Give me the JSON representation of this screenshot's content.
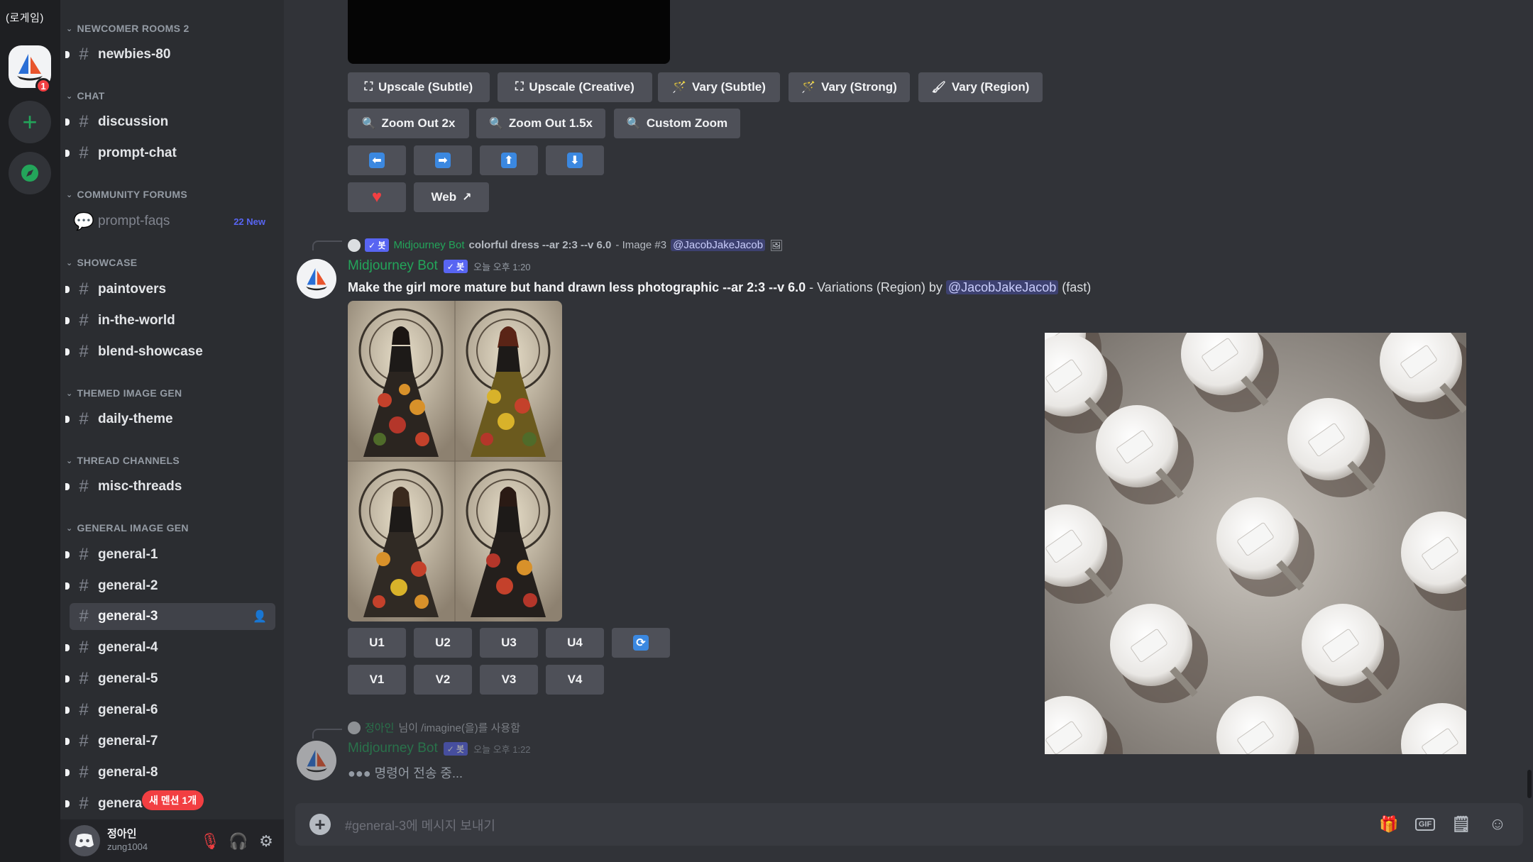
{
  "colors": {
    "accent": "#5865f2",
    "bot_green": "#23a55a",
    "danger": "#f23f42",
    "bg_main": "#313338",
    "bg_sidebar": "#2b2d31",
    "bg_rail": "#1e1f22"
  },
  "rail": {
    "top_label": "(로게임)",
    "server_badge": "1",
    "add_glyph": "+"
  },
  "sidebar": {
    "categories": {
      "newcomer": "NEWCOMER ROOMS 2",
      "chat": "CHAT",
      "forums": "COMMUNITY FORUMS",
      "showcase": "SHOWCASE",
      "themed": "THEMED IMAGE GEN",
      "threads": "THREAD CHANNELS",
      "general": "GENERAL IMAGE GEN"
    },
    "channels": {
      "newbies": "newbies-80",
      "discussion": "discussion",
      "prompt_chat": "prompt-chat",
      "prompt_faqs": "prompt-faqs",
      "prompt_faqs_new": "22 New",
      "paintovers": "paintovers",
      "in_the_world": "in-the-world",
      "blend_showcase": "blend-showcase",
      "daily_theme": "daily-theme",
      "misc_threads": "misc-threads",
      "general_1": "general-1",
      "general_2": "general-2",
      "general_3": "general-3",
      "general_4": "general-4",
      "general_5": "general-5",
      "general_6": "general-6",
      "general_7": "general-7",
      "general_8": "general-8",
      "general_9": "genera"
    },
    "new_mentions_pill": "새 멘션 1개"
  },
  "user": {
    "name": "정아인",
    "tag": "zung1004"
  },
  "message_buttons": {
    "upscale_subtle": "Upscale (Subtle)",
    "upscale_creative": "Upscale (Creative)",
    "vary_subtle": "Vary (Subtle)",
    "vary_strong": "Vary (Strong)",
    "vary_region": "Vary (Region)",
    "zoom_out_2x": "Zoom Out 2x",
    "zoom_out_15x": "Zoom Out 1.5x",
    "custom_zoom": "Custom Zoom",
    "pan_left": "⬅",
    "pan_right": "➡",
    "pan_up": "⬆",
    "pan_down": "⬇",
    "web": "Web"
  },
  "messages": [
    {
      "reply_author": "Midjourney Bot",
      "reply_text": "colorful dress --ar 2:3 --v 6.0",
      "reply_suffix": " - Image #3 ",
      "reply_mention": "@JacobJakeJacob",
      "author": "Midjourney Bot",
      "bot_tag": "✓ 봇",
      "time": "오늘 오후 1:20",
      "prompt": "Make the girl more mature but hand drawn less photographic --ar 2:3 --v 6.0",
      "suffix": " - Variations (Region) by ",
      "mention": "@JacobJakeJacob",
      "speed": " (fast)"
    },
    {
      "reply_author": "정아인",
      "reply_text": "님이 /imagine(을)를 사용함",
      "author": "Midjourney Bot",
      "bot_tag": "✓ 봇",
      "time": "오늘 오후 1:22",
      "status": "●●●  명령어 전송 중..."
    }
  ],
  "grid_buttons": {
    "u1": "U1",
    "u2": "U2",
    "u3": "U3",
    "u4": "U4",
    "v1": "V1",
    "v2": "V2",
    "v3": "V3",
    "v4": "V4"
  },
  "composer": {
    "placeholder": "#general-3에 메시지 보내기",
    "gif": "GIF"
  }
}
